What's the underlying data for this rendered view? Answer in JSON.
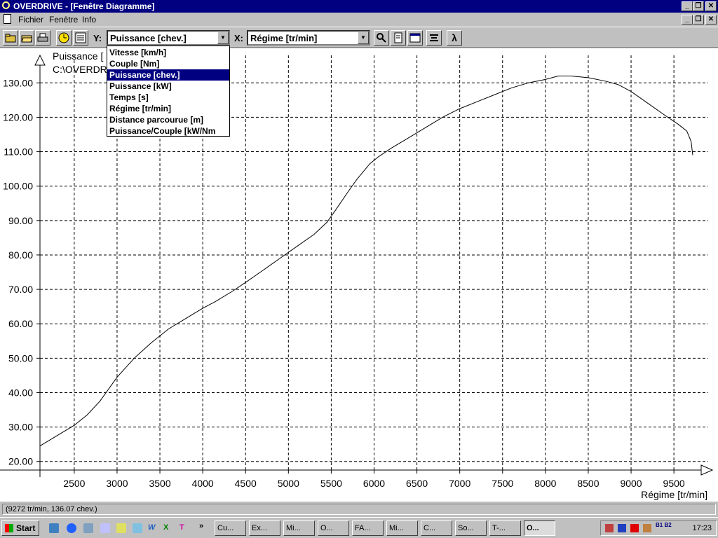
{
  "titlebar": {
    "title": "OVERDRIVE - [Fenêtre Diagramme]"
  },
  "menu": {
    "items": [
      "Fichier",
      "Fenêtre",
      "Info"
    ]
  },
  "toolbar": {
    "y_label": "Y:",
    "y_selected": "Puissance [chev.]",
    "x_label": "X:",
    "x_selected": "Régime [tr/min]",
    "lambda": "λ"
  },
  "dropdown": {
    "options": [
      "Vitesse [km/h]",
      "Couple [Nm]",
      "Puissance [chev.]",
      "Puissance [kW]",
      "Temps [s]",
      "Régime [tr/min]",
      "Distance parcourue [m]",
      "Puissance/Couple [kW/Nm"
    ],
    "selected_index": 2
  },
  "chart_data": {
    "type": "line",
    "legend_lines": [
      "Puissance [",
      "C:\\OVERDR"
    ],
    "xlabel": "Régime [tr/min]",
    "ylabel": "",
    "xlim": [
      2100,
      9900
    ],
    "ylim": [
      17.5,
      138
    ],
    "grid": true,
    "x_ticks": [
      2500,
      3000,
      3500,
      4000,
      4500,
      5000,
      5500,
      6000,
      6500,
      7000,
      7500,
      8000,
      8500,
      9000,
      9500
    ],
    "y_ticks": [
      20,
      30,
      40,
      50,
      60,
      70,
      80,
      90,
      100,
      110,
      120,
      130
    ],
    "y_tick_labels": [
      "20.00",
      "30.00",
      "40.00",
      "50.00",
      "60.00",
      "70.00",
      "80.00",
      "90.00",
      "100.00",
      "110.00",
      "120.00",
      "130.00"
    ],
    "series": [
      {
        "x": [
          2100,
          2500,
          2650,
          2800,
          3000,
          3200,
          3400,
          3600,
          3800,
          4000,
          4150,
          4350,
          4500,
          4700,
          4900,
          5100,
          5300,
          5450,
          5550,
          5700,
          5800,
          5950,
          6050,
          6200,
          6400,
          6600,
          6800,
          7000,
          7200,
          7400,
          7600,
          7800,
          8000,
          8150,
          8300,
          8500,
          8700,
          8850,
          9000,
          9200,
          9400,
          9550,
          9650,
          9700,
          9720
        ],
        "y": [
          24.5,
          30.5,
          33.5,
          37.5,
          44.5,
          50.0,
          54.5,
          58.5,
          61.5,
          64.5,
          66.5,
          69.5,
          72.0,
          75.5,
          79.0,
          82.5,
          86.0,
          89.5,
          93.0,
          98.5,
          102.0,
          106.5,
          108.5,
          111.0,
          114.0,
          117.0,
          120.0,
          122.5,
          124.5,
          126.5,
          128.5,
          130.0,
          131.0,
          132.0,
          132.0,
          131.5,
          130.5,
          129.5,
          127.5,
          124.0,
          120.5,
          118.0,
          116.0,
          113.0,
          109.0
        ]
      }
    ]
  },
  "status": {
    "text": "(9272 tr/min, 136.07 chev.)"
  },
  "taskbar": {
    "start": "Start",
    "chevron": "»",
    "tasks": [
      "Cu...",
      "Ex...",
      "Mi...",
      "O...",
      "FA...",
      "Mi...",
      "C...",
      "So...",
      "T-...",
      "O..."
    ],
    "tray_text": "B1 B2",
    "clock": "17:23"
  },
  "colors": {
    "title_bg": "#000080",
    "window": "#c0c0c0",
    "plot_bg": "#ffffff",
    "selection": "#000080"
  }
}
